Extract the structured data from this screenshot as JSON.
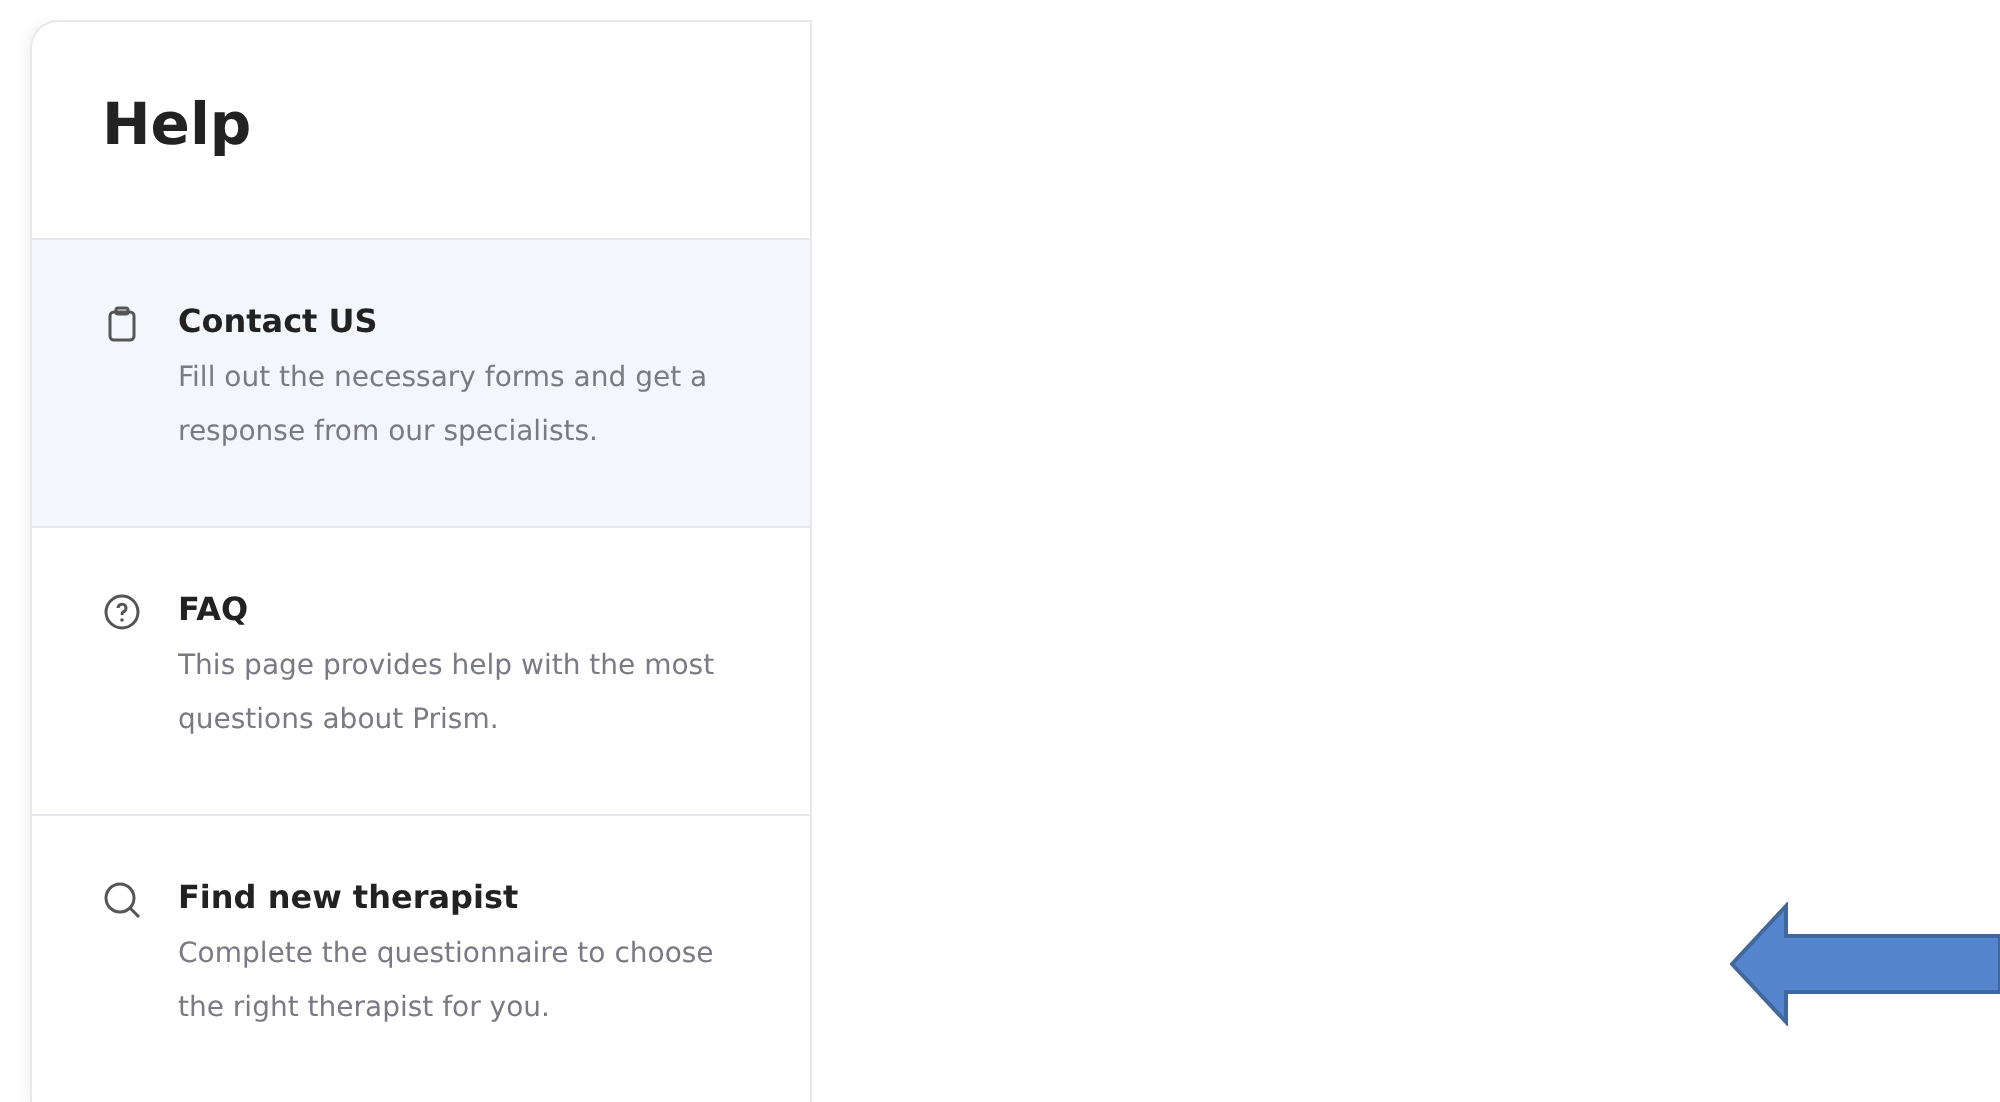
{
  "panel": {
    "title": "Help",
    "items": [
      {
        "title": "Contact US",
        "description": "Fill out the necessary forms and get a response from our specialists.",
        "selected": true
      },
      {
        "title": "FAQ",
        "description": "This page provides help with the most questions about Prism.",
        "selected": false
      },
      {
        "title": "Find new therapist",
        "description": "Complete the questionnaire to choose the right therapist for you.",
        "selected": false
      }
    ]
  }
}
